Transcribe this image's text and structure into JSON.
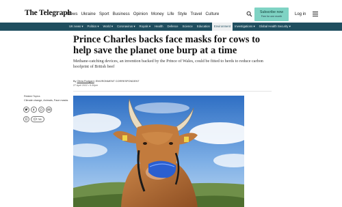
{
  "header": {
    "logo": "The Telegraph",
    "nav": [
      "News",
      "Ukraine",
      "Sport",
      "Business",
      "Opinion",
      "Money",
      "Life",
      "Style",
      "Travel",
      "Culture"
    ],
    "subscribe_line1": "Subscribe now",
    "subscribe_line2": "Free for one month",
    "login": "Log in"
  },
  "sections": {
    "items": [
      "UK news ▾",
      "Politics ▾",
      "World ▾",
      "Coronavirus ▾",
      "Royals ▾",
      "Health",
      "Defence",
      "Science",
      "Education",
      "Environment",
      "Investigations ▾",
      "Global Health Security ▾"
    ],
    "active": "Environment"
  },
  "article": {
    "headline": "Prince Charles backs face masks for cows to help save the planet one burp at a time",
    "standfirst": "Methane-catching devices, an invention backed by the Prince of Wales, could be fitted to herds to reduce carbon hoofprint of British beef",
    "byline_prefix": "By ",
    "author": "Olivia Rudgard",
    "author_role": ", ENVIRONMENT CORRESPONDENT",
    "date": "27 April 2022 • 5:30pm"
  },
  "related": {
    "heading": "Related Topics",
    "topics": "Climate change, Animals, Face masks",
    "comments_count": "765"
  },
  "colors": {
    "section_bar": "#1f4e5f",
    "subscribe_bg": "#7fd3c4"
  }
}
